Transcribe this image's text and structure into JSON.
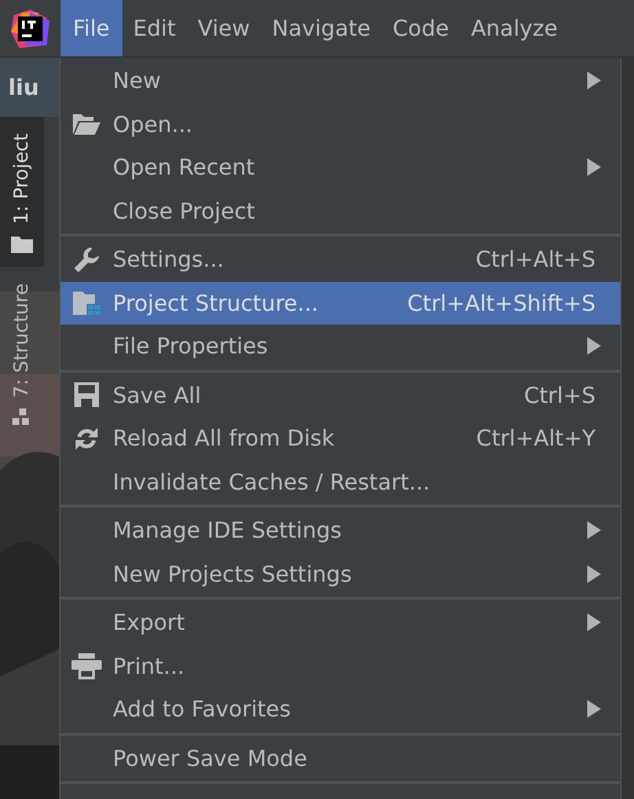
{
  "menu_bar": {
    "items": [
      {
        "label": "File",
        "selected": true
      },
      {
        "label": "Edit",
        "selected": false
      },
      {
        "label": "View",
        "selected": false
      },
      {
        "label": "Navigate",
        "selected": false
      },
      {
        "label": "Code",
        "selected": false
      },
      {
        "label": "Analyze",
        "selected": false
      }
    ]
  },
  "project_header": {
    "title": "liu"
  },
  "side_tabs": [
    {
      "label": "1: Project",
      "selected": true
    },
    {
      "label": "7: Structure",
      "selected": false
    }
  ],
  "file_menu": {
    "sections": [
      {
        "items": [
          {
            "label": "New",
            "kind": "submenu",
            "selected": false
          },
          {
            "label": "Open...",
            "kind": "action",
            "selected": false
          },
          {
            "label": "Open Recent",
            "kind": "submenu",
            "selected": false
          },
          {
            "label": "Close Project",
            "kind": "action",
            "selected": false
          }
        ]
      },
      {
        "items": [
          {
            "label": "Settings...",
            "kind": "action",
            "shortcut": "Ctrl+Alt+S",
            "selected": false
          },
          {
            "label": "Project Structure...",
            "kind": "action",
            "shortcut": "Ctrl+Alt+Shift+S",
            "selected": true
          },
          {
            "label": "File Properties",
            "kind": "submenu",
            "selected": false
          }
        ]
      },
      {
        "items": [
          {
            "label": "Save All",
            "kind": "action",
            "shortcut": "Ctrl+S",
            "selected": false
          },
          {
            "label": "Reload All from Disk",
            "kind": "action",
            "shortcut": "Ctrl+Alt+Y",
            "selected": false
          },
          {
            "label": "Invalidate Caches / Restart...",
            "kind": "action",
            "selected": false
          }
        ]
      },
      {
        "items": [
          {
            "label": "Manage IDE Settings",
            "kind": "submenu",
            "selected": false
          },
          {
            "label": "New Projects Settings",
            "kind": "submenu",
            "selected": false
          }
        ]
      },
      {
        "items": [
          {
            "label": "Export",
            "kind": "submenu",
            "selected": false
          },
          {
            "label": "Print...",
            "kind": "action",
            "selected": false
          },
          {
            "label": "Add to Favorites",
            "kind": "submenu",
            "selected": false
          }
        ]
      },
      {
        "items": [
          {
            "label": "Power Save Mode",
            "kind": "action",
            "selected": false
          }
        ]
      }
    ]
  }
}
